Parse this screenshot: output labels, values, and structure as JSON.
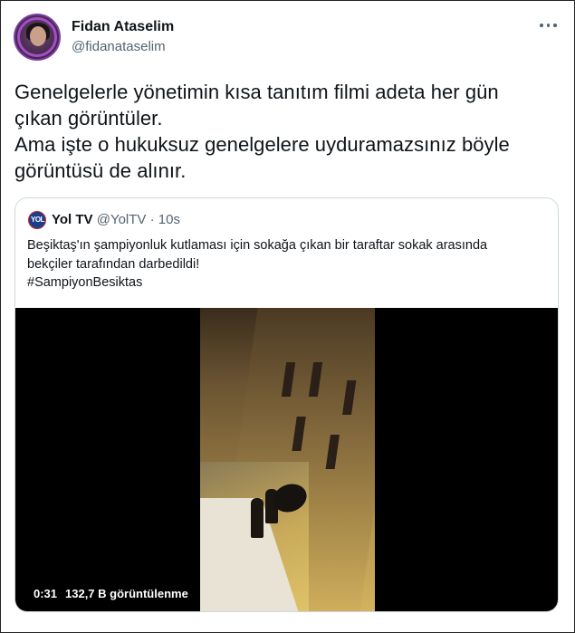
{
  "tweet": {
    "author_name": "Fidan Ataselim",
    "author_handle": "@fidanataselim",
    "text": "Genelgelerle yönetimin kısa tanıtım filmi adeta her gün\nçıkan görüntüler.\nAma işte o hukuksuz genelgelere uyduramazsınız böyle\ngörüntüsü de alınır."
  },
  "quote": {
    "avatar_text": "YOL",
    "author_name": "Yol TV",
    "author_handle": "@YolTV",
    "separator": " · ",
    "time": "10s",
    "text": "Beşiktaş'ın şampiyonluk kutlaması için sokağa çıkan bir taraftar sokak arasında\nbekçiler tarafından darbedildi!\n#SampiyonBesiktas",
    "video": {
      "duration": "0:31",
      "views": "132,7 B görüntülenme"
    }
  },
  "icons": {
    "more": "more-horizontal-icon",
    "avatar": "profile-avatar"
  }
}
